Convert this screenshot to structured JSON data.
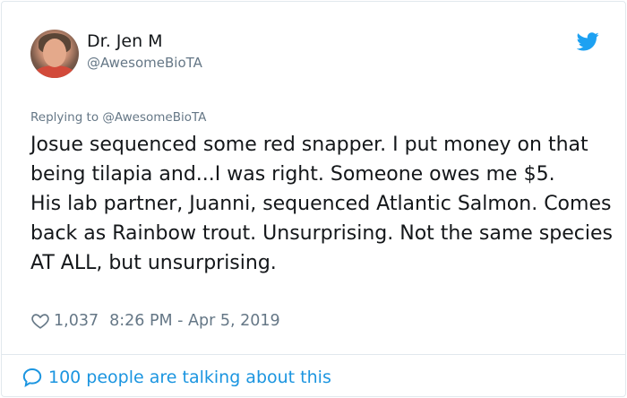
{
  "author": {
    "display_name": "Dr. Jen M",
    "handle": "@AwesomeBioTA"
  },
  "reply": {
    "prefix": "Replying to",
    "target": "@AwesomeBioTA"
  },
  "tweet": {
    "lines": [
      "Josue sequenced some red snapper. I put money on that being tilapia and...I was right. Someone owes me $5.",
      "His lab partner, Juanni, sequenced Atlantic Salmon. Comes back as Rainbow trout. Unsurprising. Not the same species AT ALL, but unsurprising."
    ],
    "like_count": "1,037",
    "timestamp": "8:26 PM - Apr 5, 2019"
  },
  "footer": {
    "talking_label": "100 people are talking about this"
  },
  "icons": {
    "brand": "twitter-bird-icon",
    "like": "heart-icon",
    "conversation": "speech-bubble-icon"
  },
  "colors": {
    "brand_blue": "#1da1f2",
    "link_blue": "#1b95e0",
    "muted_gray": "#657786",
    "text": "#14171a",
    "border": "#e1e8ed"
  }
}
